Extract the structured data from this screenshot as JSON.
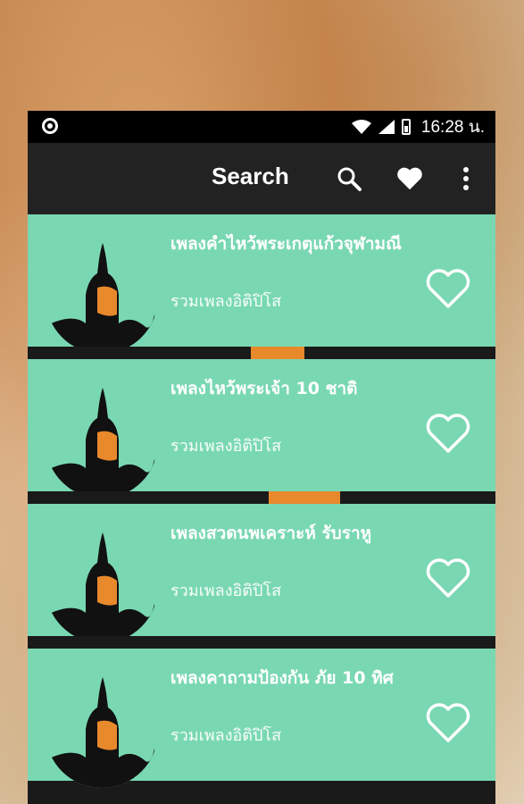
{
  "status_bar": {
    "time": "16:28 น."
  },
  "toolbar": {
    "title": "Search",
    "search_icon": "search-icon",
    "favorite_icon": "heart-icon",
    "more_icon": "more-vert-icon"
  },
  "items": [
    {
      "title": "เพลงคำไหว้พระเกตุแก้วจุฬามณี",
      "subtitle": "รวมเพลงอิติปิโส"
    },
    {
      "title": "เพลงไหว้พระเจ้า 10 ชาติ",
      "subtitle": "รวมเพลงอิติปิโส"
    },
    {
      "title": "เพลงสวดนพเคราะห์ รับราหู",
      "subtitle": "รวมเพลงอิติปิโส"
    },
    {
      "title": "เพลงคาถามป้องกัน ภัย 10 ทิศ",
      "subtitle": "รวมเพลงอิติปิโส"
    }
  ],
  "colors": {
    "card_bg": "#79d8b2",
    "toolbar_bg": "#222222",
    "robe": "#e8892b"
  }
}
